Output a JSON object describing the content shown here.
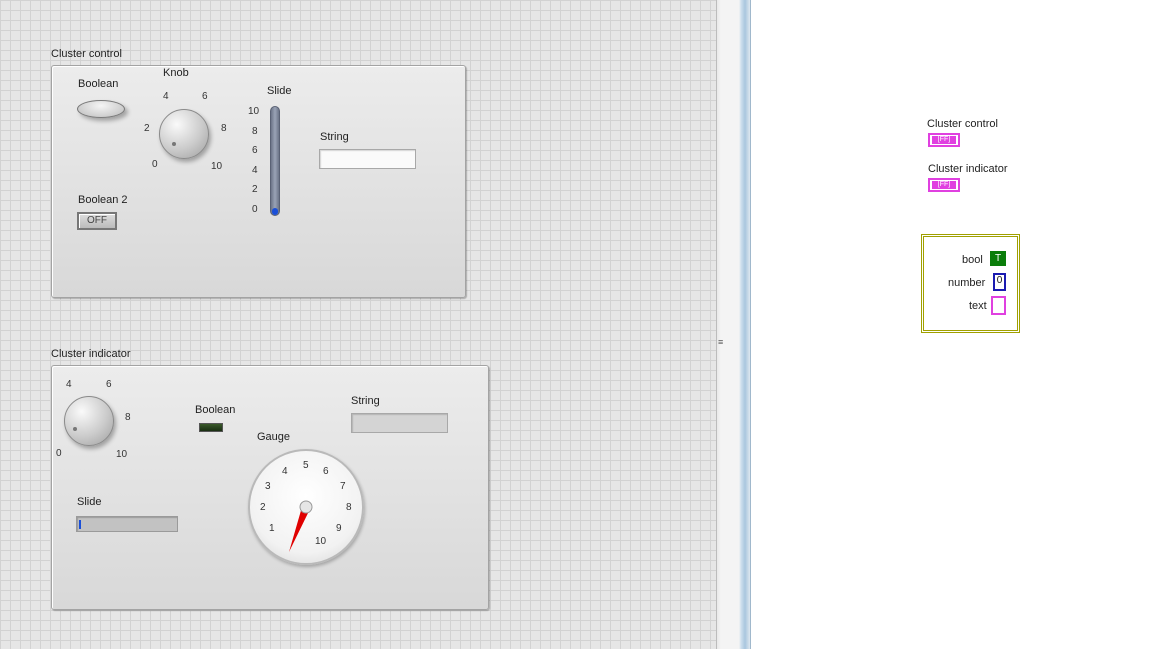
{
  "front_panel": {
    "cluster_control": {
      "label": "Cluster control",
      "boolean_label": "Boolean",
      "knob_label": "Knob",
      "knob_ticks": [
        "0",
        "2",
        "4",
        "6",
        "8",
        "10"
      ],
      "slide_label": "Slide",
      "slide_ticks": [
        "10",
        "8",
        "6",
        "4",
        "2",
        "0"
      ],
      "slide_value": 0,
      "string_label": "String",
      "string_value": "",
      "boolean2_label": "Boolean 2",
      "boolean2_button_text": "OFF"
    },
    "cluster_indicator": {
      "label": "Cluster indicator",
      "knob_ticks": [
        "0",
        "4",
        "6",
        "8",
        "10"
      ],
      "boolean_label": "Boolean",
      "string_label": "String",
      "string_value": "",
      "gauge_label": "Gauge",
      "gauge_ticks": [
        "1",
        "2",
        "3",
        "4",
        "5",
        "6",
        "7",
        "8",
        "9",
        "10"
      ],
      "slide_label": "Slide",
      "slide_value": 0
    }
  },
  "block_diagram": {
    "terminal_cluster_control": {
      "label": "Cluster control",
      "icon_text": "[FF]"
    },
    "terminal_cluster_indicator": {
      "label": "Cluster indicator",
      "icon_text": "[FF]"
    },
    "constant": {
      "rows": [
        {
          "label": "bool",
          "value": "T",
          "color": "#0a7d0a"
        },
        {
          "label": "number",
          "value": "0",
          "color": "#1a1ab0"
        },
        {
          "label": "text",
          "value": "",
          "color": "#e040e0"
        }
      ]
    }
  },
  "colors": {
    "slide_fill": "#1a4fd8",
    "gauge_needle": "#e00000",
    "cluster_wire": "#e040e0",
    "cluster_constant_border": "#a0a000"
  }
}
